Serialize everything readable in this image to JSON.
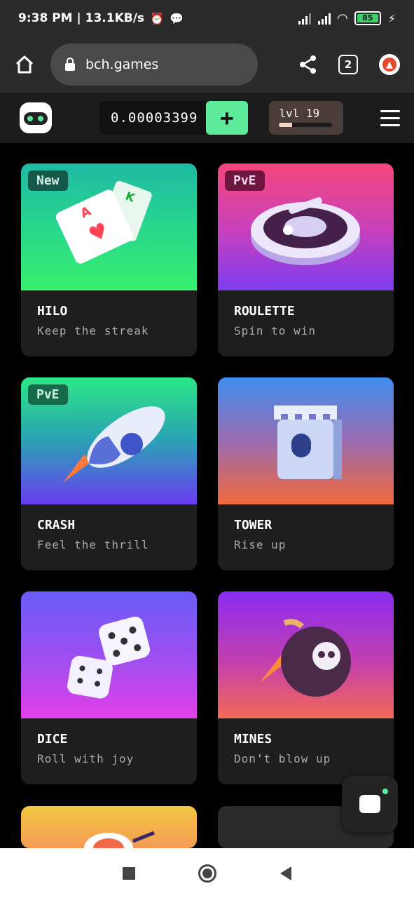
{
  "status": {
    "time_speed": "9:38 PM | 13.1KB/s",
    "battery": "85"
  },
  "browser": {
    "url": "bch.games",
    "tab_count": "2"
  },
  "header": {
    "balance": "0.00003399",
    "plus_label": "+",
    "level_label": "lvl 19",
    "level_progress": 0.25
  },
  "games": [
    {
      "title": "HILO",
      "subtitle": "Keep the streak",
      "tag": "New"
    },
    {
      "title": "ROULETTE",
      "subtitle": "Spin to win",
      "tag": "PvE"
    },
    {
      "title": "CRASH",
      "subtitle": "Feel the thrill",
      "tag": "PvE"
    },
    {
      "title": "TOWER",
      "subtitle": "Rise up",
      "tag": ""
    },
    {
      "title": "DICE",
      "subtitle": "Roll with joy",
      "tag": ""
    },
    {
      "title": "MINES",
      "subtitle": "Don’t blow up",
      "tag": ""
    }
  ],
  "colors": {
    "accent_green": "#5eeb9b",
    "card_bg": "#1e1e1e"
  }
}
